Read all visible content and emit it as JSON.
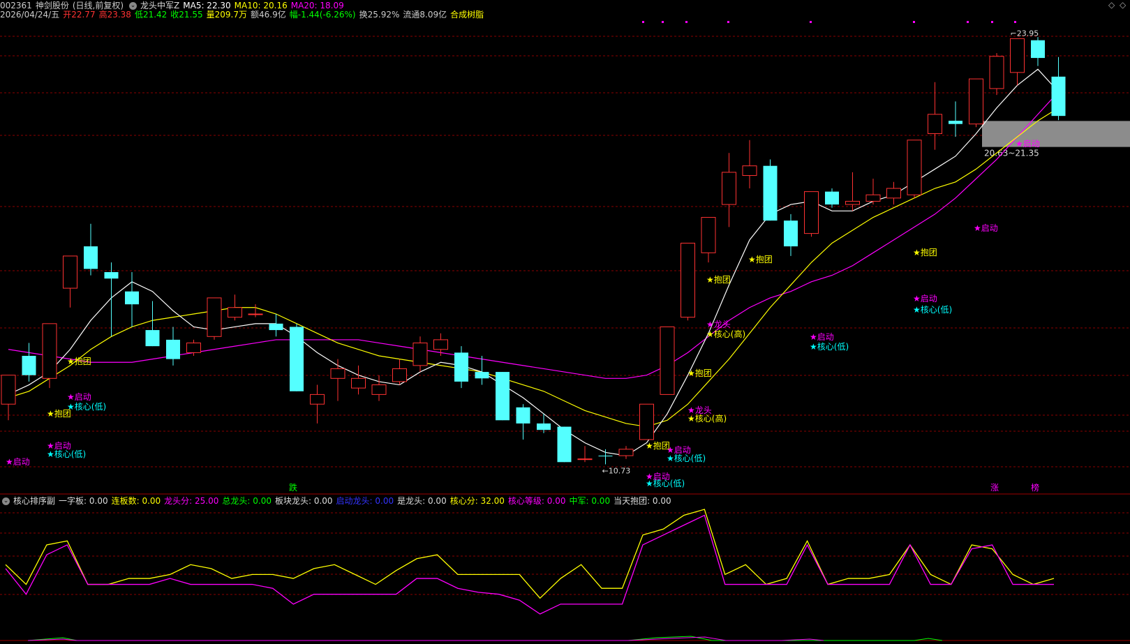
{
  "header": {
    "code": "002361",
    "name": "神剑股份",
    "mode": "(日线,前复权)",
    "indicator": "龙头中军Z",
    "ma5_label": "MA5: 22.30",
    "ma10_label": "MA10: 20.16",
    "ma20_label": "MA20: 18.09"
  },
  "quote": {
    "date": "2026/04/24/五",
    "open": "开22.77",
    "high": "高23.38",
    "low": "低21.42",
    "close": "收21.55",
    "volume": "量209.7万",
    "amount": "额46.9亿",
    "change": "幅-1.44(-6.26%)",
    "turnover": "换25.92%",
    "float": "流通8.09亿",
    "concept": "合成树脂"
  },
  "annotations": {
    "high_price": "23.95",
    "low_price": "10.73",
    "zone_label": "20.63~21.35",
    "marker_die": "跌",
    "marker_zhang": "涨",
    "marker_bang": "榜"
  },
  "tags": {
    "qidong": "★启动",
    "baotuan": "★抱团",
    "hexin_low": "★核心(低)",
    "hexin_high": "★核心(高)",
    "longtou": "★龙头"
  },
  "sub_header": {
    "title": "核心排序副",
    "yiziban": "一字板: 0.00",
    "lianban": "连板数: 0.00",
    "longtou_score": "龙头分: 25.00",
    "total_longtou": "总龙头: 0.00",
    "block_longtou": "板块龙头: 0.00",
    "start_longtou": "启动龙头: 0.00",
    "is_longtou": "是龙头: 0.00",
    "core_score": "核心分: 32.00",
    "core_level": "核心等级: 0.00",
    "zhongjun": "中军: 0.00",
    "today_baotuan": "当天抱团: 0.00"
  },
  "colors": {
    "up": "#ff3232",
    "down": "#54ffff",
    "ma5": "#ffffff",
    "ma10": "#ffff00",
    "ma20": "#ff00ff",
    "grid": "#8b0000",
    "label_yellow": "#ffff00",
    "label_magenta": "#ff00ff",
    "label_cyan": "#00ffff"
  },
  "chart_data": {
    "type": "candlestick",
    "price_range": [
      10.2,
      24.5
    ],
    "candles": [
      {
        "o": 12.6,
        "h": 13.5,
        "l": 12.1,
        "c": 13.5
      },
      {
        "o": 14.1,
        "h": 14.5,
        "l": 13.3,
        "c": 13.5
      },
      {
        "o": 13.4,
        "h": 15.1,
        "l": 13.1,
        "c": 15.1
      },
      {
        "o": 16.2,
        "h": 17.2,
        "l": 15.6,
        "c": 17.2
      },
      {
        "o": 17.5,
        "h": 18.2,
        "l": 16.6,
        "c": 16.8
      },
      {
        "o": 16.7,
        "h": 17.0,
        "l": 14.7,
        "c": 16.5
      },
      {
        "o": 16.1,
        "h": 16.7,
        "l": 15.0,
        "c": 15.7
      },
      {
        "o": 14.9,
        "h": 15.8,
        "l": 14.4,
        "c": 14.4
      },
      {
        "o": 14.6,
        "h": 15.0,
        "l": 13.8,
        "c": 14.0
      },
      {
        "o": 14.2,
        "h": 14.6,
        "l": 14.1,
        "c": 14.5
      },
      {
        "o": 14.7,
        "h": 15.9,
        "l": 14.6,
        "c": 15.9
      },
      {
        "o": 15.3,
        "h": 16.0,
        "l": 15.2,
        "c": 15.6
      },
      {
        "o": 15.4,
        "h": 15.7,
        "l": 15.3,
        "c": 15.4
      },
      {
        "o": 15.1,
        "h": 15.4,
        "l": 14.7,
        "c": 14.9
      },
      {
        "o": 15.0,
        "h": 15.1,
        "l": 13.0,
        "c": 13.0
      },
      {
        "o": 12.6,
        "h": 13.2,
        "l": 12.0,
        "c": 12.9
      },
      {
        "o": 13.4,
        "h": 14.0,
        "l": 12.7,
        "c": 13.7
      },
      {
        "o": 13.1,
        "h": 13.8,
        "l": 12.9,
        "c": 13.4
      },
      {
        "o": 12.9,
        "h": 13.5,
        "l": 12.7,
        "c": 13.2
      },
      {
        "o": 13.3,
        "h": 14.0,
        "l": 13.2,
        "c": 13.7
      },
      {
        "o": 13.8,
        "h": 14.7,
        "l": 13.6,
        "c": 14.5
      },
      {
        "o": 14.3,
        "h": 14.8,
        "l": 14.1,
        "c": 14.6
      },
      {
        "o": 14.2,
        "h": 14.4,
        "l": 13.1,
        "c": 13.3
      },
      {
        "o": 13.6,
        "h": 14.1,
        "l": 13.2,
        "c": 13.4
      },
      {
        "o": 13.6,
        "h": 13.6,
        "l": 12.1,
        "c": 12.1
      },
      {
        "o": 12.5,
        "h": 12.6,
        "l": 11.5,
        "c": 12.0
      },
      {
        "o": 12.0,
        "h": 12.3,
        "l": 11.7,
        "c": 11.8
      },
      {
        "o": 11.9,
        "h": 11.9,
        "l": 10.8,
        "c": 10.8
      },
      {
        "o": 10.9,
        "h": 11.3,
        "l": 10.8,
        "c": 10.9
      },
      {
        "o": 11.0,
        "h": 11.2,
        "l": 10.73,
        "c": 10.98
      },
      {
        "o": 11.0,
        "h": 11.3,
        "l": 10.9,
        "c": 11.2
      },
      {
        "o": 11.5,
        "h": 12.6,
        "l": 11.5,
        "c": 12.6
      },
      {
        "o": 12.9,
        "h": 15.0,
        "l": 12.9,
        "c": 15.0
      },
      {
        "o": 15.3,
        "h": 17.6,
        "l": 15.2,
        "c": 17.6
      },
      {
        "o": 17.3,
        "h": 18.4,
        "l": 17.0,
        "c": 18.4
      },
      {
        "o": 18.8,
        "h": 20.4,
        "l": 18.1,
        "c": 19.8
      },
      {
        "o": 19.7,
        "h": 20.8,
        "l": 19.3,
        "c": 20.0
      },
      {
        "o": 20.0,
        "h": 20.2,
        "l": 18.3,
        "c": 18.3
      },
      {
        "o": 18.3,
        "h": 18.5,
        "l": 17.2,
        "c": 17.5
      },
      {
        "o": 17.9,
        "h": 19.2,
        "l": 17.8,
        "c": 19.2
      },
      {
        "o": 19.2,
        "h": 19.3,
        "l": 18.7,
        "c": 18.8
      },
      {
        "o": 18.8,
        "h": 19.8,
        "l": 18.6,
        "c": 18.9
      },
      {
        "o": 18.9,
        "h": 19.6,
        "l": 18.8,
        "c": 19.1
      },
      {
        "o": 19.0,
        "h": 19.5,
        "l": 18.8,
        "c": 19.3
      },
      {
        "o": 19.1,
        "h": 20.8,
        "l": 19.0,
        "c": 20.8
      },
      {
        "o": 21.0,
        "h": 22.6,
        "l": 20.5,
        "c": 21.6
      },
      {
        "o": 21.4,
        "h": 22.0,
        "l": 20.9,
        "c": 21.3
      },
      {
        "o": 21.3,
        "h": 22.7,
        "l": 21.2,
        "c": 22.7
      },
      {
        "o": 22.4,
        "h": 23.5,
        "l": 22.2,
        "c": 23.4
      },
      {
        "o": 22.9,
        "h": 23.95,
        "l": 22.5,
        "c": 23.95
      },
      {
        "o": 23.9,
        "h": 24.0,
        "l": 23.1,
        "c": 23.35
      },
      {
        "o": 22.77,
        "h": 23.38,
        "l": 21.42,
        "c": 21.55
      }
    ],
    "ma5": [
      12.9,
      13.2,
      13.6,
      14.3,
      15.2,
      15.9,
      16.4,
      16.1,
      15.5,
      15.0,
      14.9,
      15.0,
      15.1,
      15.1,
      14.7,
      14.2,
      13.8,
      13.5,
      13.3,
      13.2,
      13.6,
      13.9,
      13.8,
      13.6,
      13.2,
      12.8,
      12.3,
      11.8,
      11.4,
      11.1,
      11.0,
      11.4,
      12.3,
      13.5,
      14.8,
      16.3,
      17.7,
      18.5,
      18.8,
      18.9,
      18.6,
      18.6,
      18.9,
      19.1,
      19.5,
      19.9,
      20.3,
      21.0,
      21.8,
      22.5,
      23.0,
      22.3
    ],
    "ma10": [
      12.8,
      13.0,
      13.4,
      13.8,
      14.3,
      14.7,
      15.0,
      15.2,
      15.3,
      15.4,
      15.5,
      15.6,
      15.6,
      15.4,
      15.1,
      14.8,
      14.5,
      14.3,
      14.1,
      14.0,
      13.9,
      13.8,
      13.7,
      13.6,
      13.4,
      13.2,
      13.0,
      12.7,
      12.4,
      12.2,
      12.0,
      11.9,
      12.1,
      12.6,
      13.3,
      14.0,
      14.8,
      15.6,
      16.3,
      17.0,
      17.6,
      18.0,
      18.4,
      18.7,
      19.0,
      19.3,
      19.5,
      19.9,
      20.4,
      20.9,
      21.4,
      21.8
    ],
    "ma20": [
      14.3,
      14.2,
      14.1,
      14.0,
      13.9,
      13.9,
      13.9,
      14.0,
      14.1,
      14.2,
      14.3,
      14.4,
      14.5,
      14.6,
      14.6,
      14.6,
      14.6,
      14.6,
      14.5,
      14.4,
      14.3,
      14.2,
      14.1,
      14.0,
      13.9,
      13.8,
      13.7,
      13.6,
      13.5,
      13.4,
      13.4,
      13.5,
      13.8,
      14.2,
      14.7,
      15.2,
      15.6,
      15.9,
      16.1,
      16.4,
      16.6,
      16.9,
      17.3,
      17.7,
      18.1,
      18.5,
      19.0,
      19.6,
      20.2,
      20.9,
      21.6,
      22.3
    ],
    "sub_series": [
      {
        "name": "核心分",
        "values": [
          50,
          40,
          60,
          62,
          40,
          40,
          43,
          43,
          45,
          50,
          48,
          43,
          45,
          45,
          43,
          48,
          50,
          45,
          40,
          47,
          53,
          55,
          45,
          45,
          45,
          45,
          33,
          43,
          50,
          38,
          38,
          65,
          68,
          75,
          78,
          45,
          50,
          40,
          43,
          62,
          40,
          43,
          43,
          45,
          60,
          45,
          40,
          60,
          58,
          45,
          40,
          43
        ]
      },
      {
        "name": "龙头分",
        "values": [
          48,
          35,
          55,
          60,
          40,
          40,
          40,
          40,
          43,
          40,
          40,
          40,
          40,
          38,
          30,
          35,
          35,
          35,
          35,
          35,
          43,
          43,
          38,
          36,
          35,
          32,
          25,
          30,
          30,
          30,
          30,
          60,
          65,
          70,
          75,
          40,
          40,
          40,
          40,
          60,
          40,
          40,
          40,
          40,
          60,
          40,
          40,
          58,
          60,
          40,
          40,
          40
        ]
      }
    ]
  }
}
